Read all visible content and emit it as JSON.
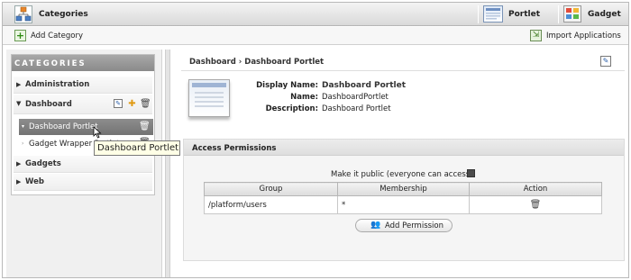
{
  "header": {
    "app_title": "Categories",
    "tabs": [
      {
        "label": "Portlet",
        "icon": "portlet-icon"
      },
      {
        "label": "Gadget",
        "icon": "gadget-icon"
      }
    ]
  },
  "toolbar": {
    "add_category_label": "Add Category",
    "import_label": "Import Applications"
  },
  "sidebar": {
    "heading": "CATEGORIES",
    "categories": [
      {
        "label": "Administration",
        "expanded": false
      },
      {
        "label": "Dashboard",
        "expanded": true,
        "portlets": [
          "Dashboard Portlet",
          "Gadget Wrapper Portlet"
        ]
      },
      {
        "label": "Gadgets",
        "expanded": false
      },
      {
        "label": "Web",
        "expanded": false
      }
    ],
    "tooltip": "Dashboard Portlet"
  },
  "detail": {
    "breadcrumb": "Dashboard › Dashboard Portlet",
    "fields": [
      {
        "key": "Display Name:",
        "value": "Dashboard Portlet"
      },
      {
        "key": "Name:",
        "value": "DashboardPortlet"
      },
      {
        "key": "Description:",
        "value": "Dashboard Portlet"
      }
    ]
  },
  "access": {
    "heading": "Access Permissions",
    "make_public_label": "Make it public (everyone can access):",
    "columns": [
      "Group",
      "Membership",
      "Action"
    ],
    "rows": [
      {
        "group": "/platform/users",
        "membership": "*"
      }
    ],
    "add_permission_label": "Add Permission"
  },
  "colors": {
    "selected_row": "#7f7f7f",
    "header_gray": "#9a9a9a",
    "tooltip_bg": "#ffffe6"
  }
}
